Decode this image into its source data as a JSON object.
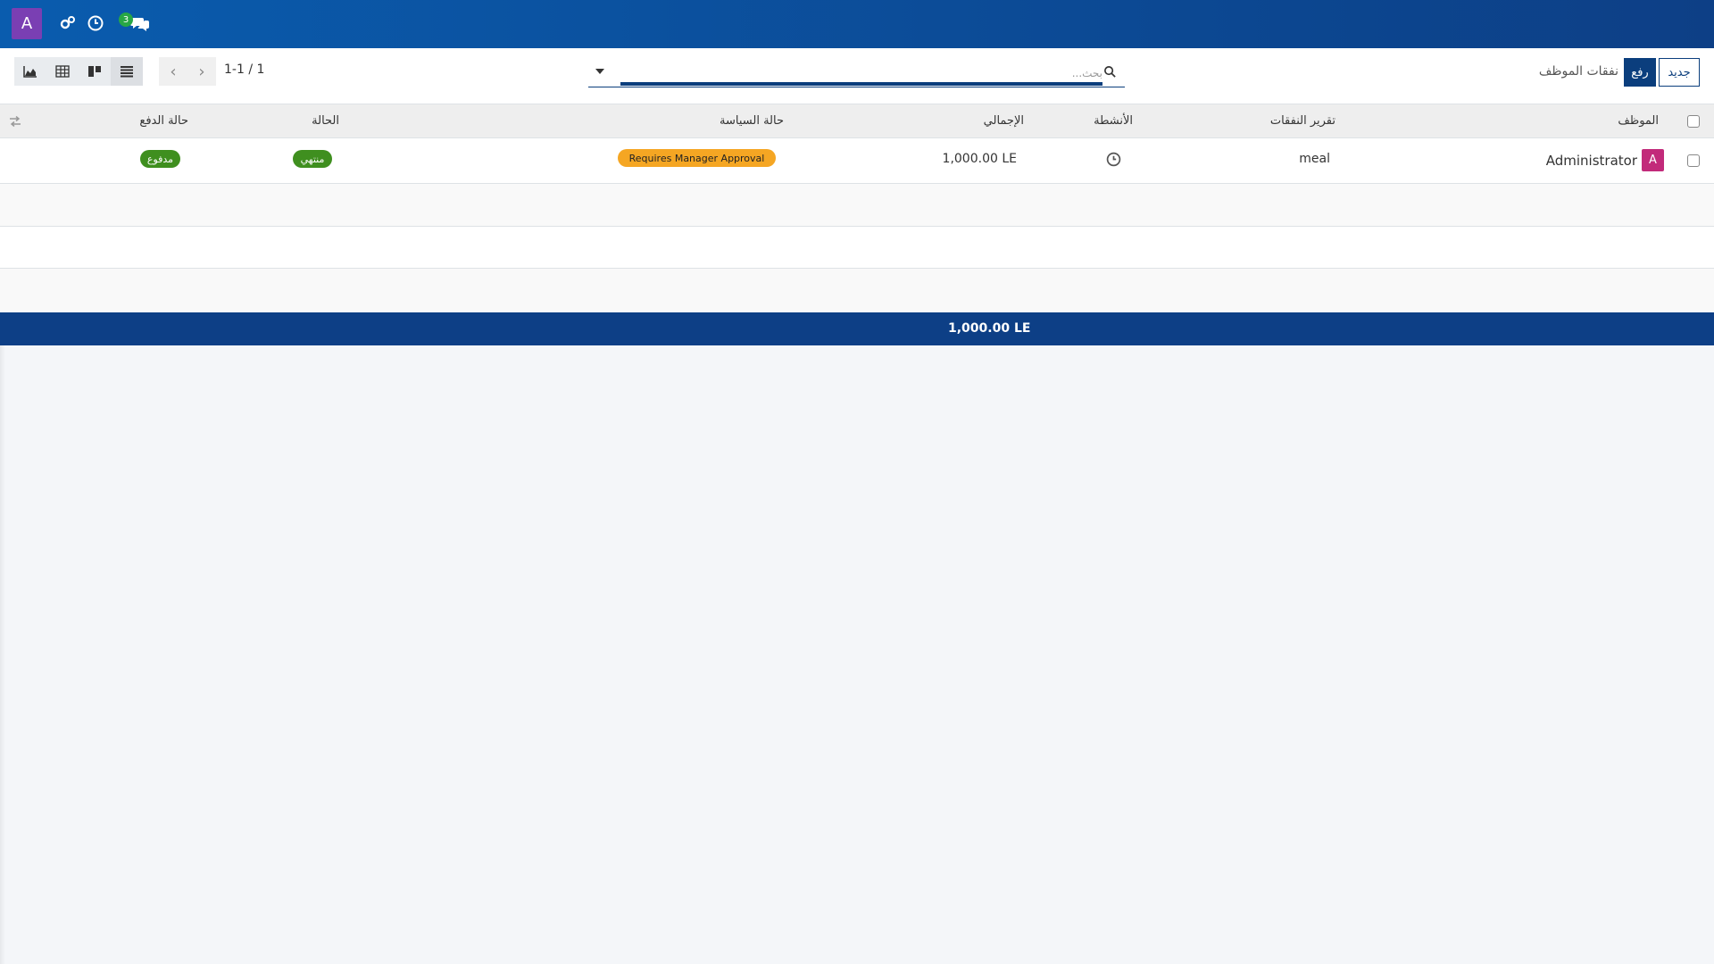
{
  "topbar": {
    "avatar_letter": "A",
    "messages_badge": "3",
    "icons": [
      "settings-debug-icon",
      "clock-icon",
      "chat-icon"
    ]
  },
  "control_panel": {
    "new_button": "جديد",
    "upload_button": "رفع",
    "breadcrumb": "نفقات الموظف",
    "search_placeholder": "بحث...",
    "pager": "1-1 / 1"
  },
  "list": {
    "headers": {
      "employee": "الموظف",
      "expense_report": "تقرير النفقات",
      "activities": "الأنشطة",
      "total": "الإجمالي",
      "policy_status": "حالة السياسة",
      "status": "الحالة",
      "payment_status": "حالة الدفع"
    },
    "rows": [
      {
        "avatar_letter": "A",
        "employee": "Administrator",
        "expense_report": "meal",
        "total": "1,000.00 LE",
        "policy_status": "Requires Manager Approval",
        "status": "منتهي",
        "payment_status": "مدفوع"
      }
    ],
    "footer_total": "1,000.00 LE"
  },
  "colors": {
    "topbar": "#0d3f86",
    "primary": "#0b3e7d",
    "policy_badge": "#f5a623",
    "status_badge": "#3f8f1f",
    "avatar_user": "#7a3fb3",
    "avatar_employee": "#c22a7a"
  }
}
